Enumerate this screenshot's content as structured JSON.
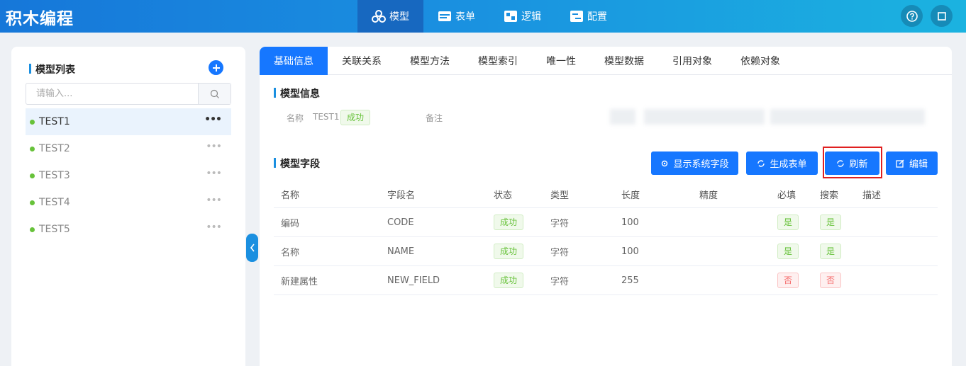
{
  "header": {
    "brand": "积木编程",
    "nav": [
      {
        "label": "模型",
        "icon": "cubes-icon",
        "active": true
      },
      {
        "label": "表单",
        "icon": "form-icon",
        "active": false
      },
      {
        "label": "逻辑",
        "icon": "logic-icon",
        "active": false
      },
      {
        "label": "配置",
        "icon": "config-icon",
        "active": false
      }
    ],
    "help_icon": "help-circle-icon",
    "window_icon": "square-icon"
  },
  "sidebar": {
    "title": "模型列表",
    "search_placeholder": "请输入...",
    "items": [
      {
        "label": "TEST1",
        "status": "green",
        "active": true
      },
      {
        "label": "TEST2",
        "status": "green",
        "active": false
      },
      {
        "label": "TEST3",
        "status": "green",
        "active": false
      },
      {
        "label": "TEST4",
        "status": "green",
        "active": false
      },
      {
        "label": "TEST5",
        "status": "green",
        "active": false
      }
    ],
    "more_glyph": "•••"
  },
  "tabs": [
    "基础信息",
    "关联关系",
    "模型方法",
    "模型索引",
    "唯一性",
    "模型数据",
    "引用对象",
    "依赖对象"
  ],
  "model_info": {
    "title": "模型信息",
    "name_label": "名称",
    "name_value": "TEST1",
    "status": "成功",
    "remark_label": "备注"
  },
  "fields": {
    "title": "模型字段",
    "buttons": {
      "show_system": "显示系统字段",
      "generate_form": "生成表单",
      "refresh": "刷新",
      "edit": "编辑"
    },
    "columns": [
      "名称",
      "字段名",
      "状态",
      "类型",
      "长度",
      "精度",
      "必填",
      "搜索",
      "描述"
    ],
    "rows": [
      {
        "name": "编码",
        "field": "CODE",
        "status": "成功",
        "type": "字符",
        "length": "100",
        "precision": "",
        "required": "是",
        "search": "是",
        "desc": ""
      },
      {
        "name": "名称",
        "field": "NAME",
        "status": "成功",
        "type": "字符",
        "length": "100",
        "precision": "",
        "required": "是",
        "search": "是",
        "desc": ""
      },
      {
        "name": "新建属性",
        "field": "NEW_FIELD",
        "status": "成功",
        "type": "字符",
        "length": "255",
        "precision": "",
        "required": "否",
        "search": "否",
        "desc": ""
      }
    ]
  },
  "colors": {
    "primary": "#1677ff",
    "header_start": "#1677d9",
    "header_end": "#1bb3e0",
    "success": "#67c23a",
    "danger": "#f56c6c",
    "highlight": "#e02020"
  }
}
